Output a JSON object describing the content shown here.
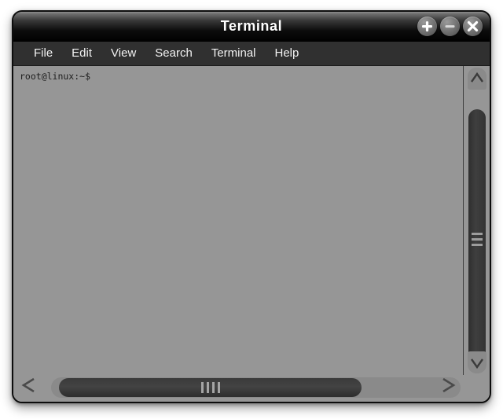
{
  "window": {
    "title": "Terminal",
    "controls": [
      {
        "name": "maximize-button",
        "glyph": "plus",
        "label": "+"
      },
      {
        "name": "minimize-button",
        "glyph": "minus",
        "label": "−"
      },
      {
        "name": "close-button",
        "glyph": "close",
        "label": "×"
      }
    ]
  },
  "menubar": {
    "items": [
      {
        "label": "File"
      },
      {
        "label": "Edit"
      },
      {
        "label": "View"
      },
      {
        "label": "Search"
      },
      {
        "label": "Terminal"
      },
      {
        "label": "Help"
      }
    ]
  },
  "terminal": {
    "prompt": "root@linux:~$",
    "lines": [
      "root@linux:~$"
    ],
    "background_color": "#969696",
    "foreground_color": "#1d1d1d"
  },
  "scrollbars": {
    "vertical": {
      "up_arrow_icon": "chevron-up-icon",
      "down_arrow_icon": "chevron-down-icon",
      "grip_line_count": 3
    },
    "horizontal": {
      "left_arrow_icon": "chevron-left-icon",
      "right_arrow_icon": "chevron-right-icon",
      "grip_line_count": 4
    }
  },
  "colors": {
    "titlebar_top": "#8e8e8e",
    "titlebar_bottom": "#000000",
    "menubar": "#303030",
    "terminal": "#969696",
    "thumb": "#3a3a3a",
    "border": "#0d0d0d"
  }
}
